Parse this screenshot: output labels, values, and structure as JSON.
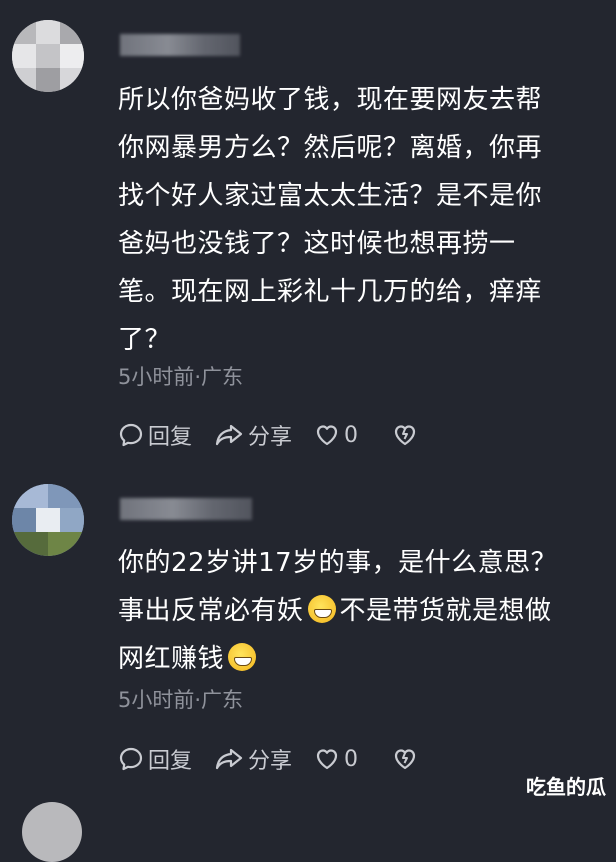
{
  "comments": [
    {
      "username": "",
      "lines": [
        "所以你爸妈收了钱，现在要网友去帮",
        "你网暴男方么？然后呢？离婚，你再",
        "找个好人家过富太太生活？是不是你",
        "爸妈也没钱了？这时候也想再捞一",
        "笔。现在网上彩礼十几万的给，痒痒",
        "了？"
      ],
      "meta": "5小时前·广东",
      "reply_label": "回复",
      "share_label": "分享",
      "like_count": "0"
    },
    {
      "username": "",
      "lines": [
        "你的22岁讲17岁的事，是什么意思？",
        "事出反常必有妖",
        "不是带货就是想做",
        "网红赚钱"
      ],
      "meta": "5小时前·广东",
      "reply_label": "回复",
      "share_label": "分享",
      "like_count": "0"
    }
  ],
  "icons": {
    "reply": "comment-bubble-icon",
    "share": "share-arrow-icon",
    "like": "heart-icon",
    "dislike": "broken-heart-icon",
    "emoji": "grinning-face-emoji"
  },
  "watermark": "吃鱼的瓜",
  "colors": {
    "background": "#23262f",
    "text": "#ffffff",
    "meta": "#8f929b",
    "action": "#c9cbd1"
  }
}
